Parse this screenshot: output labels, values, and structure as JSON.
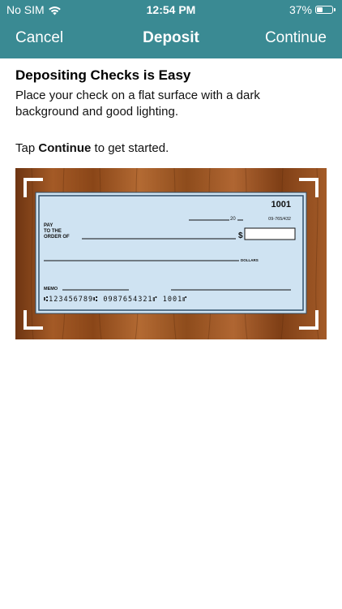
{
  "status_bar": {
    "carrier": "No SIM",
    "time": "12:54 PM",
    "battery": "37%",
    "battery_level": 0.37,
    "wifi_icon": "wifi-icon"
  },
  "nav": {
    "cancel": "Cancel",
    "title": "Deposit",
    "continue": "Continue"
  },
  "instructions": {
    "heading": "Depositing Checks is Easy",
    "description": "Place your check on a flat surface with a dark background and good lighting.",
    "tap_prefix": "Tap ",
    "tap_bold": "Continue",
    "tap_suffix": " to get started."
  },
  "check": {
    "number": "1001",
    "date_suffix": "20",
    "routing_fraction": "09-765/432",
    "pay_line1": "PAY",
    "pay_line2": "TO THE",
    "pay_line3": "ORDER OF",
    "dollar_sign": "$",
    "dollars": "DOLLARS",
    "memo": "MEMO",
    "micr": "⑆123456789⑆  0987654321⑈  1001⑈"
  },
  "colors": {
    "header_bg": "#3a8a93",
    "check_bg": "#cfe3f2",
    "wood": "#8a4a20"
  }
}
